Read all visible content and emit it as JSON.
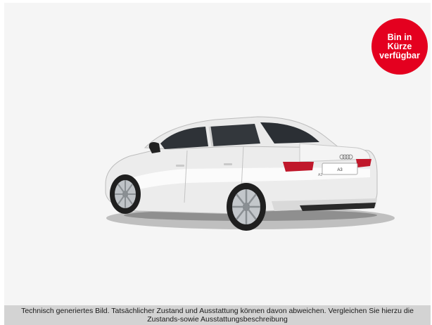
{
  "badge": {
    "text": "Bin in Kürze verfügbar",
    "color": "#e4001f"
  },
  "vehicle_image": {
    "plate_text": "A3",
    "model_badge": "A3"
  },
  "disclaimer": {
    "text": "Technisch generiertes Bild. Tatsächlicher Zustand und Ausstattung können davon abweichen. Vergleichen Sie hierzu die Zustands-sowie Ausstattungsbeschreibung"
  }
}
